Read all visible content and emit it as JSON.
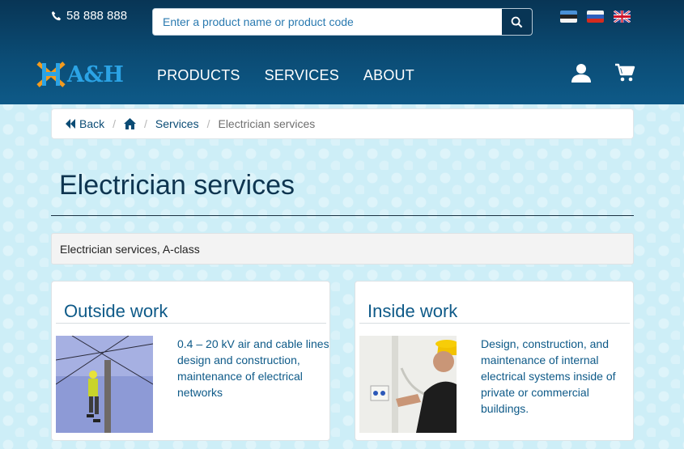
{
  "header": {
    "phone": "58 888 888",
    "search": {
      "placeholder": "Enter a product name or product code"
    },
    "languages": [
      "estonian-flag-icon",
      "russian-flag-icon",
      "uk-flag-icon"
    ],
    "logo_text": "A&H",
    "nav": [
      {
        "label": "PRODUCTS"
      },
      {
        "label": "SERVICES"
      },
      {
        "label": "ABOUT"
      }
    ],
    "icons": [
      "user-icon",
      "cart-icon"
    ]
  },
  "breadcrumb": {
    "back": "Back",
    "home_icon": "home-icon",
    "services": "Services",
    "current": "Electrician services"
  },
  "page": {
    "title": "Electrician services",
    "notice": "Electrician services, A-class"
  },
  "cards": [
    {
      "title": "Outside work",
      "text": "0.4 – 20 kV air and cable lines design and construction, maintenance of electrical networks"
    },
    {
      "title": "Inside work",
      "text": "Design, construction, and maintenance of internal electrical systems inside of private or commercial buildings."
    }
  ],
  "colors": {
    "header_dark": "#083555",
    "accent": "#0e5a88",
    "logo_blue": "#2ba3e5",
    "logo_orange": "#f39b1f",
    "page_bg": "#cdeef7"
  }
}
